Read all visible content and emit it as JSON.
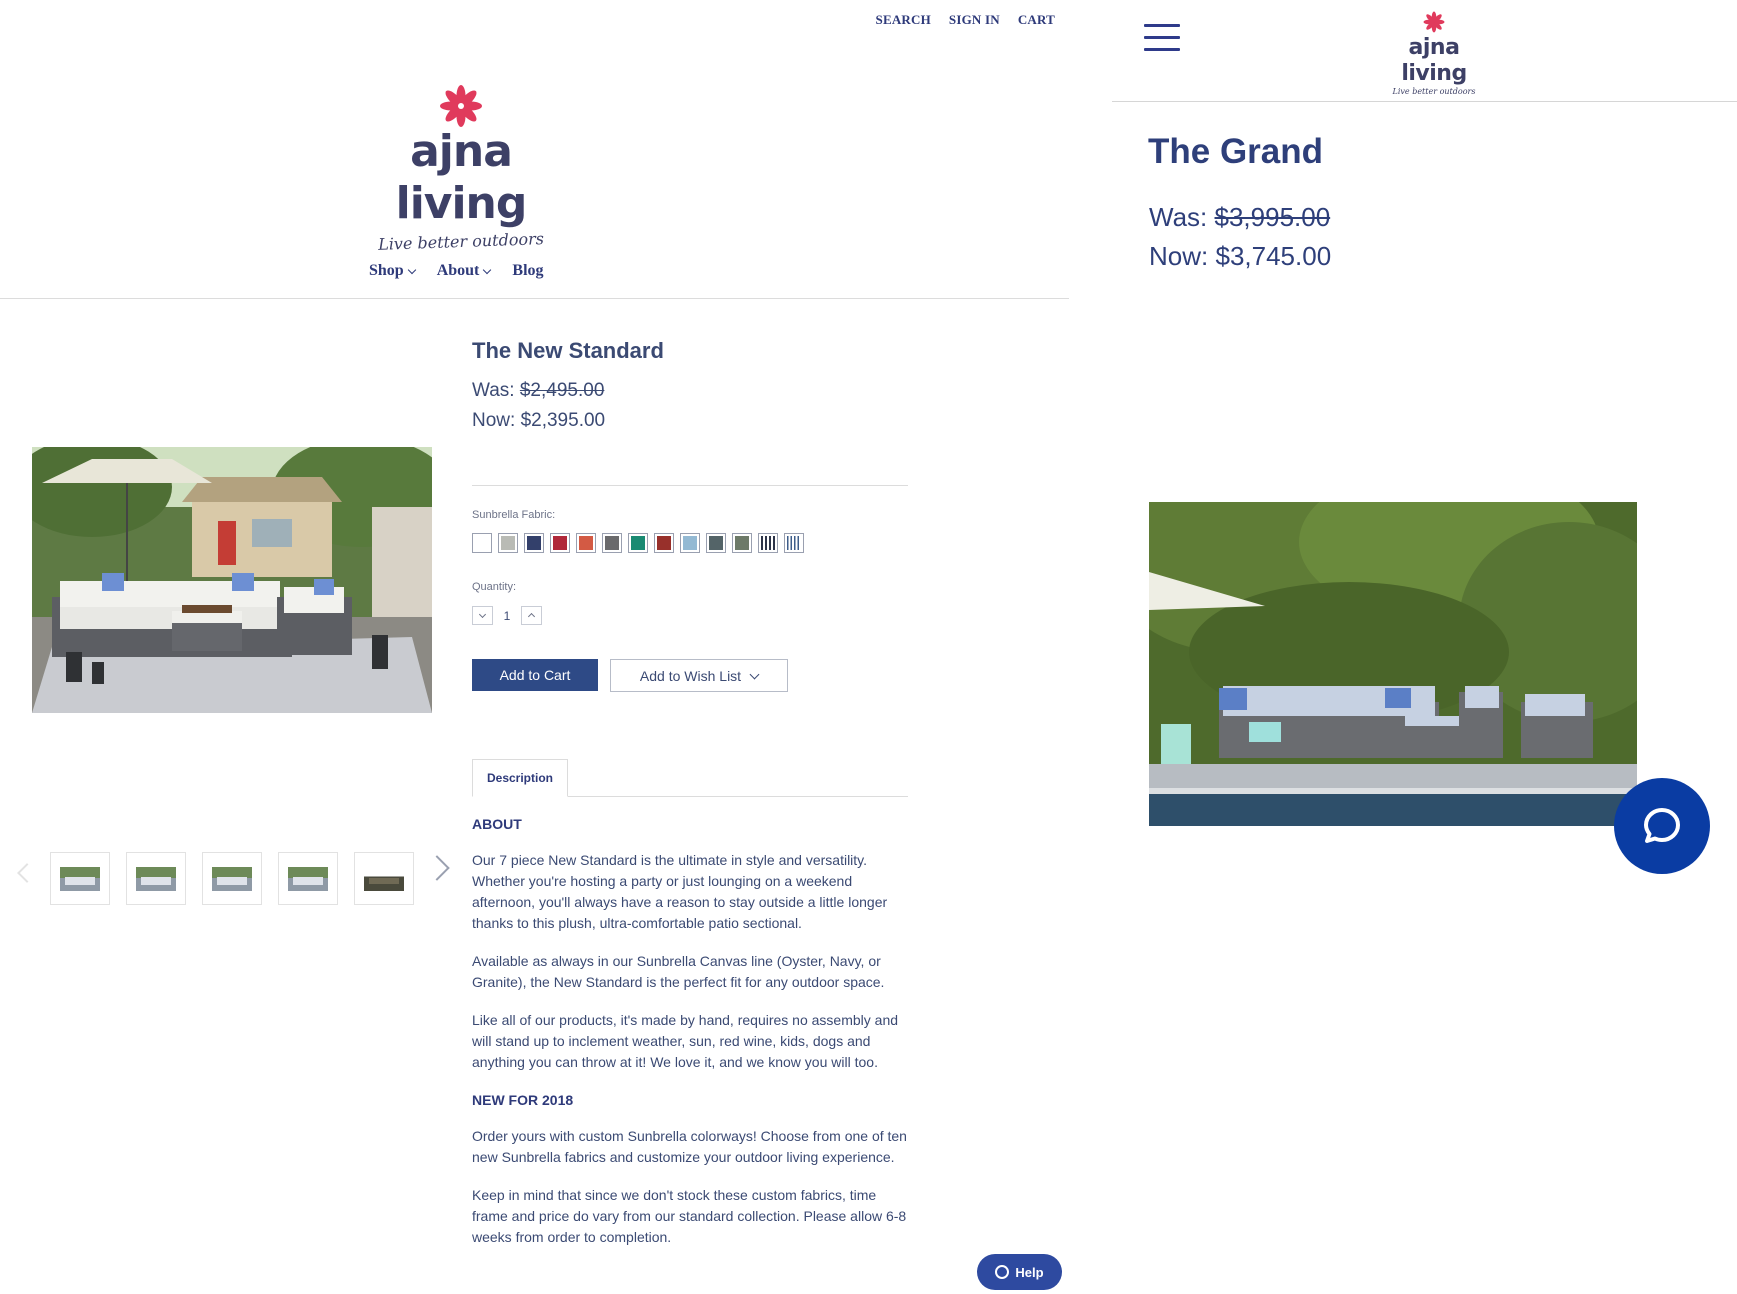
{
  "desktop": {
    "utility_nav": [
      "SEARCH",
      "SIGN IN",
      "CART"
    ],
    "logo": {
      "wordmark": "ajna living",
      "tagline": "Live better outdoors"
    },
    "main_nav": [
      "Shop",
      "About",
      "Blog"
    ],
    "product": {
      "title": "The New Standard",
      "was_label": "Was:",
      "was_price": "$2,495.00",
      "now_label": "Now:",
      "now_price": "$2,395.00",
      "fabric_label": "Sunbrella Fabric:",
      "swatch_colors": [
        "#ffffff",
        "#b9bbb5",
        "#33406b",
        "#b0283a",
        "#d35a44",
        "#6a6a6c",
        "#1a8a72",
        "#98302b",
        "#93b9d3",
        "#546468",
        "#6d7a68",
        "stripe",
        "stripe2"
      ],
      "quantity_label": "Quantity:",
      "quantity_value": "1",
      "add_to_cart": "Add to Cart",
      "add_to_wishlist": "Add to Wish List"
    },
    "tabs": [
      "Description"
    ],
    "description": {
      "heading_about": "ABOUT",
      "p1": "Our 7 piece New Standard is the ultimate in style and versatility. Whether you're hosting a party or just lounging on a weekend afternoon, you'll always have a reason to stay outside a little longer thanks to this plush, ultra-comfortable patio sectional.",
      "p2": "Available as always in our Sunbrella Canvas line (Oyster, Navy, or Granite), the New Standard is the perfect fit for any outdoor space.",
      "p3": "Like all of our products, it's made by hand, requires no assembly and will stand up to inclement weather, sun, red wine, kids, dogs and anything you can throw at it!  We love it, and we know you will too.",
      "heading_new": "NEW FOR 2018",
      "p4": "Order yours with custom Sunbrella colorways! Choose from one of ten new Sunbrella fabrics and customize your outdoor living experience.",
      "p5": "Keep in mind that since we don't stock these custom fabrics, time frame and price do vary from our standard collection. Please allow 6-8 weeks from order to completion."
    },
    "help_label": "Help",
    "accent_color": "#2e4a86",
    "logo_flower_color": "#e03a5c"
  },
  "mobile": {
    "logo": {
      "wordmark": "ajna living",
      "tagline": "Live better outdoors"
    },
    "product": {
      "title": "The Grand",
      "was_label": "Was:",
      "was_price": "$3,995.00",
      "now_label": "Now:",
      "now_price": "$3,745.00"
    },
    "chat_color": "#0a3ca3"
  }
}
